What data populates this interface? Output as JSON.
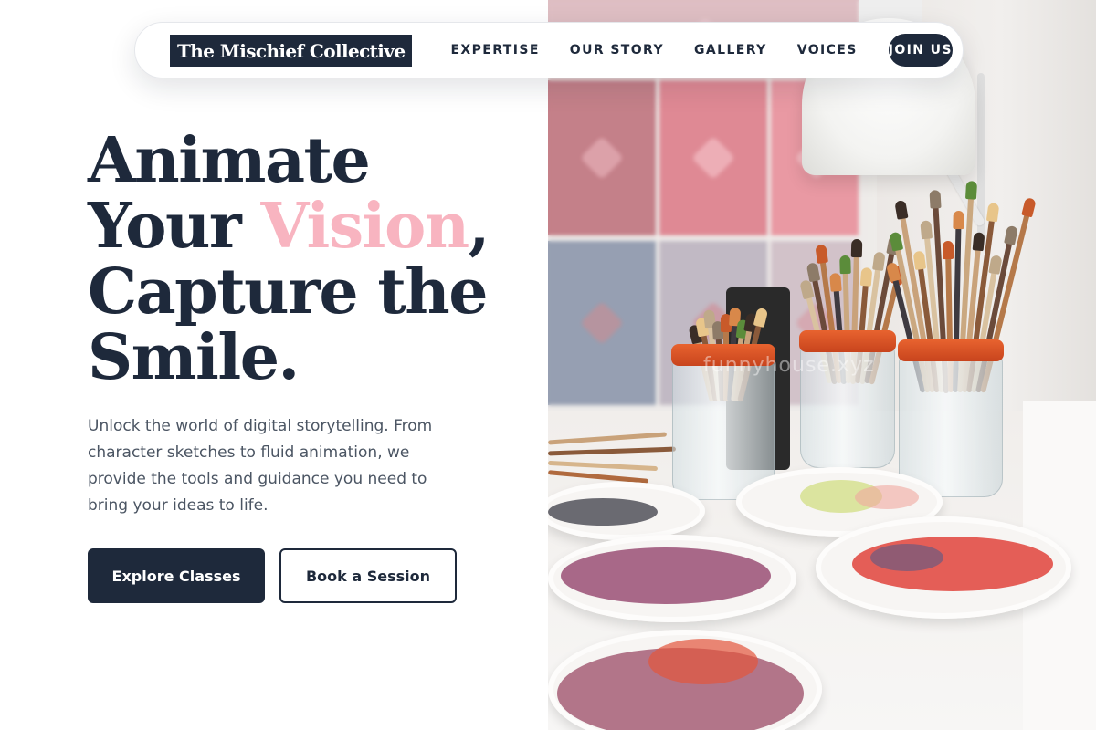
{
  "nav": {
    "logo": "The Mischief Collective",
    "links": [
      "EXPERTISE",
      "OUR STORY",
      "GALLERY",
      "VOICES"
    ],
    "cta": "JOIN US"
  },
  "hero": {
    "headline": {
      "line1": "Animate",
      "line2_pre": "Your ",
      "line2_accent": "Vision",
      "line2_post": ",",
      "line3": "Capture the",
      "line4": "Smile."
    },
    "lead": "Unlock the world of digital storytelling. From character sketches to fluid animation, we provide the tools and guidance you need to bring your ideas to life.",
    "primary_button": "Explore Classes",
    "secondary_button": "Book a Session"
  },
  "image": {
    "watermark": "funnyhouse.xyz"
  },
  "colors": {
    "primary": "#1e293b",
    "accent": "#f8b4c0",
    "body_text": "#4b5563",
    "background": "#ffffff"
  }
}
